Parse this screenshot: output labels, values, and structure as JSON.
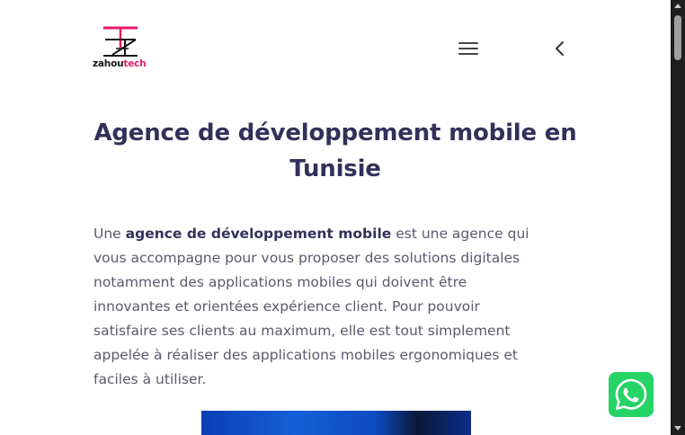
{
  "header": {
    "logo": {
      "text_dark": "zahou",
      "text_accent": "tech",
      "accent_color": "#e5196a",
      "dark_color": "#141414"
    },
    "menu_icon": "hamburger-icon",
    "back_icon": "chevron-left-icon"
  },
  "main": {
    "title_line1": "Agence de développement mobile en",
    "title_line2": "Tunisie",
    "intro": {
      "line1_before": "Une ",
      "line1_bold": "agence de développement mobile",
      "line1_after": " est une agence qui",
      "line2": "vous accompagne pour vous proposer des solutions digitales",
      "line3": "notamment des applications mobiles qui doivent être",
      "line4": "innovantes et orientées expérience client. Pour pouvoir",
      "line5": "satisfaire ses clients au maximum, elle est tout simplement",
      "line6": "appelée à réaliser des applications mobiles ergonomiques et",
      "line7": "faciles à utiliser."
    },
    "title_color": "#33315a",
    "text_color": "#5a5a6e"
  },
  "floating": {
    "whatsapp_icon": "whatsapp-icon",
    "whatsapp_color": "#25d366"
  }
}
